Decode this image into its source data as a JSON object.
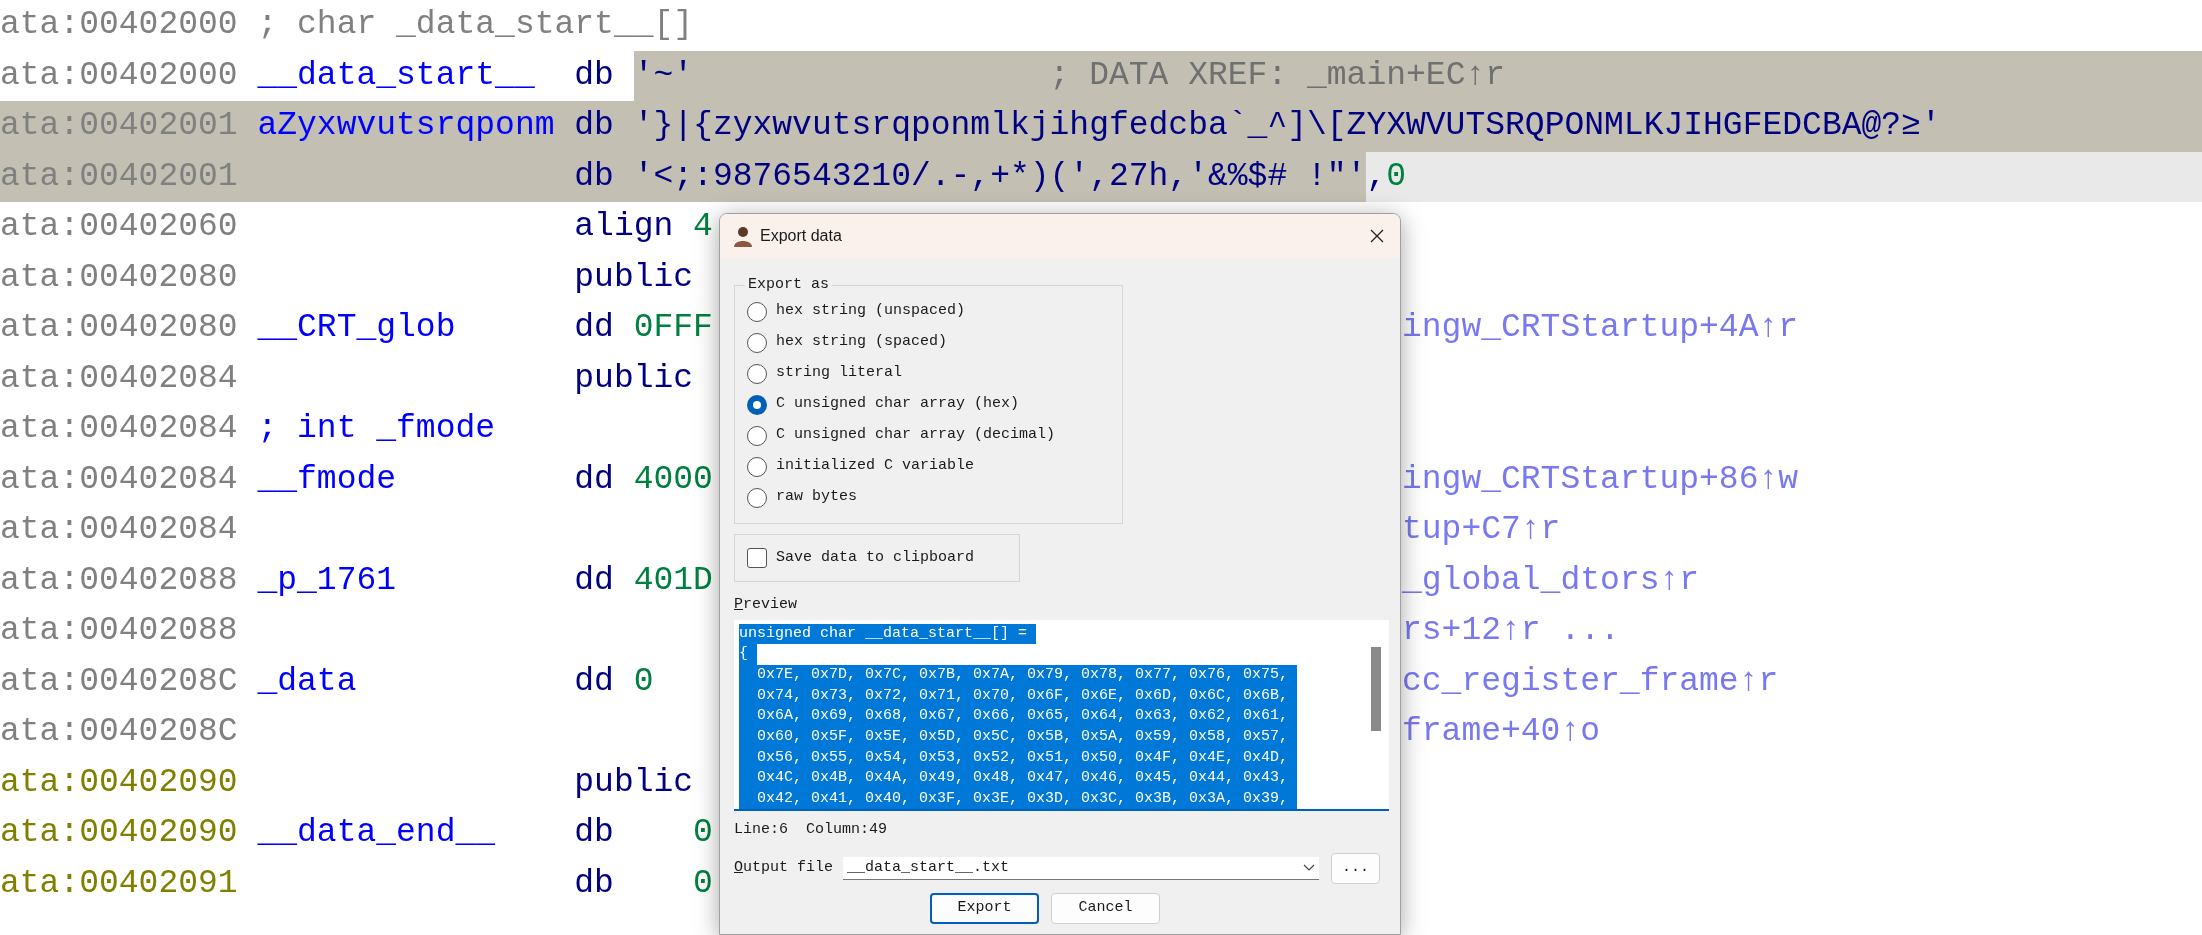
{
  "listing": {
    "rows": [
      {
        "address": "ata:00402000",
        "color": "#808080",
        "label": {
          "text": "; char _data_start__[]",
          "kind": "comment"
        },
        "kind": "plain"
      },
      {
        "address": "ata:00402000",
        "color": "#808080",
        "label": {
          "text": "__data_start__",
          "kind": "name"
        },
        "mnemonic": "db",
        "operand": [
          {
            "text": "'~'",
            "kind": "string"
          }
        ],
        "comment": "; DATA XREF: _main+EC↑r",
        "kind": "operand_selected"
      },
      {
        "address": "ata:00402001",
        "color": "#808080",
        "label": {
          "text": "aZyxwvutsrqponm",
          "kind": "name"
        },
        "mnemonic": "db",
        "operand": [
          {
            "text": "'}|{zyxwvutsrqponmlkjihgfedcba`_^]\\[ZYXWVUTSRQPONMLKJIHGFEDCBA@?≥'",
            "kind": "string"
          }
        ],
        "kind": "selected"
      },
      {
        "address": "ata:00402001",
        "color": "#808080",
        "mnemonic": "db",
        "operand": [
          {
            "text": "'<;:9876543210/.-,+*)(',27h,'&%$# !\"'",
            "kind": "string"
          },
          {
            "text": ",",
            "kind": "punct"
          },
          {
            "text": "0",
            "kind": "number"
          }
        ],
        "kind": "partly_selected"
      },
      {
        "address": "ata:00402060",
        "color": "#808080",
        "mnemonic": "align",
        "operand": [
          {
            "text": "4",
            "kind": "number"
          }
        ],
        "kind": "plain"
      },
      {
        "address": "ata:00402080",
        "color": "#808080",
        "mnemonic": "public",
        "kind": "plain"
      },
      {
        "address": "ata:00402080",
        "color": "#808080",
        "label": {
          "text": "__CRT_glob",
          "kind": "name"
        },
        "mnemonic": "dd",
        "operand": [
          {
            "text": "0FFF",
            "kind": "number"
          }
        ],
        "xref": "ingw_CRTStartup+4A↑r",
        "kind": "plain"
      },
      {
        "address": "ata:00402084",
        "color": "#808080",
        "mnemonic": "public",
        "kind": "plain"
      },
      {
        "address": "ata:00402084",
        "color": "#808080",
        "label": {
          "text": "; int _fmode",
          "kind": "declaration"
        },
        "kind": "plain"
      },
      {
        "address": "ata:00402084",
        "color": "#808080",
        "label": {
          "text": "__fmode",
          "kind": "name"
        },
        "mnemonic": "dd",
        "operand": [
          {
            "text": "4000",
            "kind": "number"
          }
        ],
        "xref": "ingw_CRTStartup+86↑w",
        "kind": "plain"
      },
      {
        "address": "ata:00402084",
        "color": "#808080",
        "xref": "tup+C7↑r",
        "kind": "plain"
      },
      {
        "address": "ata:00402088",
        "color": "#808080",
        "label": {
          "text": "_p_1761",
          "kind": "name"
        },
        "mnemonic": "dd",
        "operand": [
          {
            "text": "401D",
            "kind": "number"
          }
        ],
        "xref": "_global_dtors↑r",
        "kind": "plain"
      },
      {
        "address": "ata:00402088",
        "color": "#808080",
        "xref": "rs+12↑r ...",
        "kind": "plain"
      },
      {
        "address": "ata:0040208C",
        "color": "#808080",
        "label": {
          "text": "_data",
          "kind": "name"
        },
        "mnemonic": "dd",
        "operand": [
          {
            "text": "0",
            "kind": "number"
          }
        ],
        "xref": "cc_register_frame↑r",
        "kind": "plain"
      },
      {
        "address": "ata:0040208C",
        "color": "#808080",
        "xref": "frame+40↑o",
        "kind": "plain"
      },
      {
        "address": "ata:00402090",
        "color": "#808000",
        "mnemonic": "public",
        "kind": "plain"
      },
      {
        "address": "ata:00402090",
        "color": "#808000",
        "label": {
          "text": "__data_end__",
          "kind": "name"
        },
        "mnemonic": "db",
        "operand": [
          {
            "text": "0",
            "kind": "byte"
          }
        ],
        "kind": "plain"
      },
      {
        "address": "ata:00402091",
        "color": "#808000",
        "mnemonic": "db",
        "operand": [
          {
            "text": "0",
            "kind": "byte"
          }
        ],
        "kind": "plain"
      }
    ]
  },
  "dialog": {
    "title": "Export data",
    "export_as": {
      "legend": "Export as",
      "options": [
        {
          "label": "hex string (unspaced)",
          "selected": false
        },
        {
          "label": "hex string (spaced)",
          "selected": false
        },
        {
          "label": "string literal",
          "selected": false
        },
        {
          "label": "C unsigned char array (hex)",
          "selected": true
        },
        {
          "label": "C unsigned char array (decimal)",
          "selected": false
        },
        {
          "label": "initialized C variable",
          "selected": false
        },
        {
          "label": "raw bytes",
          "selected": false
        }
      ]
    },
    "save_to_clipboard": {
      "label": "Save data to clipboard",
      "checked": false
    },
    "preview": {
      "access_key": "P",
      "label_rest": "review",
      "selected": true,
      "lines": [
        {
          "text": "unsigned char __data_start__[] =",
          "kind": "code"
        },
        {
          "text": "{",
          "kind": "code"
        },
        {
          "text": "0x7E, 0x7D, 0x7C, 0x7B, 0x7A, 0x79, 0x78, 0x77, 0x76, 0x75,",
          "kind": "item"
        },
        {
          "text": "0x74, 0x73, 0x72, 0x71, 0x70, 0x6F, 0x6E, 0x6D, 0x6C, 0x6B,",
          "kind": "item"
        },
        {
          "text": "0x6A, 0x69, 0x68, 0x67, 0x66, 0x65, 0x64, 0x63, 0x62, 0x61,",
          "kind": "item"
        },
        {
          "text": "0x60, 0x5F, 0x5E, 0x5D, 0x5C, 0x5B, 0x5A, 0x59, 0x58, 0x57,",
          "kind": "item"
        },
        {
          "text": "0x56, 0x55, 0x54, 0x53, 0x52, 0x51, 0x50, 0x4F, 0x4E, 0x4D,",
          "kind": "item"
        },
        {
          "text": "0x4C, 0x4B, 0x4A, 0x49, 0x48, 0x47, 0x46, 0x45, 0x44, 0x43,",
          "kind": "item"
        },
        {
          "text": "0x42, 0x41, 0x40, 0x3F, 0x3E, 0x3D, 0x3C, 0x3B, 0x3A, 0x39,",
          "kind": "item"
        }
      ]
    },
    "cursor_line": "Line:6",
    "cursor_column": "Column:49",
    "output_file": {
      "access_key": "O",
      "label_rest": "utput file",
      "value": "__data_start__.txt",
      "browse": "..."
    },
    "buttons": [
      {
        "label": "Export",
        "default": true
      },
      {
        "label": "Cancel",
        "default": false
      }
    ]
  }
}
